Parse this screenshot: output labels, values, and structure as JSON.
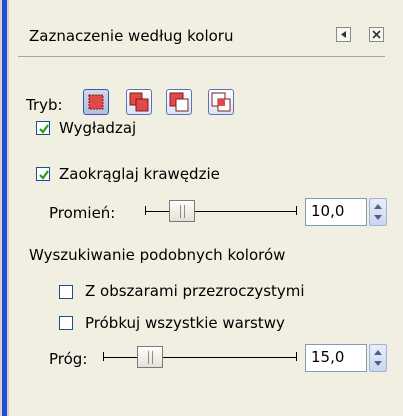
{
  "dialog": {
    "title": "Zaznaczenie według koloru"
  },
  "mode": {
    "label": "Tryb:",
    "buttons": [
      "replace-selection-icon",
      "add-to-selection-icon",
      "subtract-from-selection-icon",
      "intersect-selection-icon"
    ],
    "active_index": 0
  },
  "antialias": {
    "label": "Wygładzaj",
    "checked": true
  },
  "feather": {
    "label": "Zaokrąglaj krawędzie",
    "checked": true
  },
  "radius": {
    "label": "Promień:",
    "value": "10,0",
    "slider_fraction": 0.2
  },
  "similar": {
    "heading": "Wyszukiwanie podobnych kolorów",
    "transparent": {
      "label": "Z obszarami przezroczystymi",
      "checked": false
    },
    "sample_merged": {
      "label": "Próbkuj wszystkie warstwy",
      "checked": false
    }
  },
  "threshold": {
    "label": "Próg:",
    "value": "15,0",
    "slider_fraction": 0.2
  },
  "colors": {
    "panel": "#f1efe2",
    "checkbox_border": "#1c5180",
    "check_mark": "#21a121",
    "mode_icon_fill": "#e24848",
    "left_bar": "#1f4fd0"
  }
}
